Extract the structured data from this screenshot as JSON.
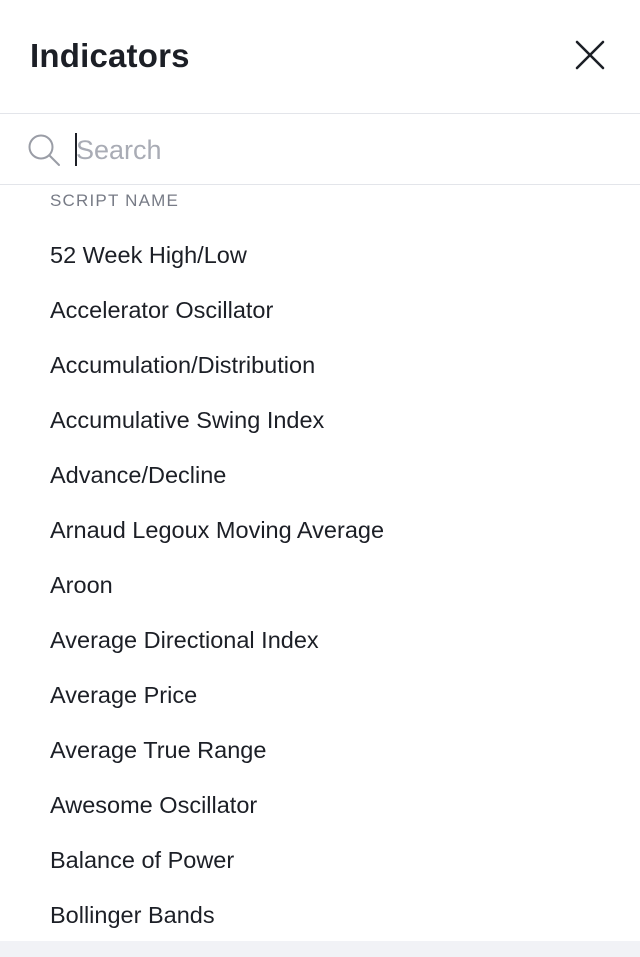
{
  "header": {
    "title": "Indicators",
    "close_icon": "close-icon"
  },
  "search": {
    "placeholder": "Search",
    "value": "",
    "icon": "search-icon"
  },
  "section": {
    "label": "SCRIPT NAME"
  },
  "indicators": [
    "52 Week High/Low",
    "Accelerator Oscillator",
    "Accumulation/Distribution",
    "Accumulative Swing Index",
    "Advance/Decline",
    "Arnaud Legoux Moving Average",
    "Aroon",
    "Average Directional Index",
    "Average Price",
    "Average True Range",
    "Awesome Oscillator",
    "Balance of Power",
    "Bollinger Bands"
  ],
  "colors": {
    "text": "#1c1f26",
    "muted": "#777b86",
    "divider": "#e3e5ea",
    "placeholder": "#a9acb5"
  }
}
